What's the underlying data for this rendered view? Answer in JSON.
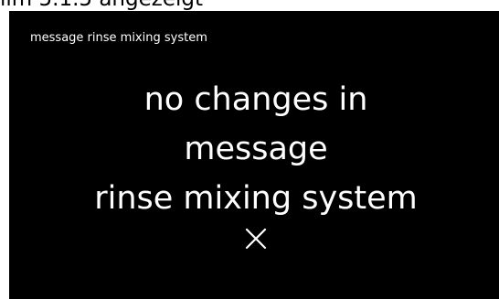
{
  "document": {
    "caption": "ilm 5.1.5 angezeigt"
  },
  "screen": {
    "title": "message rinse mixing system",
    "message_lines": [
      "no changes in",
      "message",
      "rinse mixing system"
    ],
    "close_icon": "close-icon"
  },
  "colors": {
    "screen_background": "#000000",
    "text": "#ffffff"
  }
}
